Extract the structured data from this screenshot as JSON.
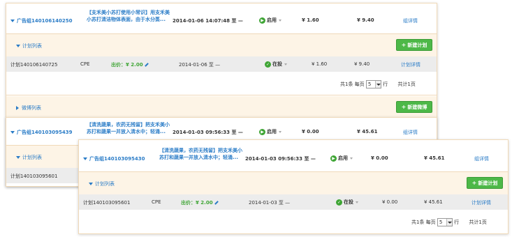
{
  "back": {
    "ad1": {
      "group_label": "广告组140106140250",
      "title": "【支禾美小苏打使用小常识】用支禾美小苏打清洁物体表面，由于水分蒸...",
      "date": "2014-01-06 14:07:48 至 —",
      "status": "启用",
      "price1": "¥ 1.60",
      "price2": "¥ 9.40",
      "detail": "组详情",
      "plan_list": "计划列表",
      "new_plan_btn": "新建计划",
      "plan": {
        "name": "计划140106140725",
        "type": "CPE",
        "bid_label": "出价：¥ 2.00",
        "date": "2014-01-06 至 —",
        "status": "在投",
        "v1": "¥ 1.60",
        "v2": "¥ 9.40",
        "detail": "计划详情"
      },
      "pager": {
        "total": "共1条 每页",
        "size": "5",
        "unit": "行",
        "pages": "共计1页"
      },
      "weibo_list": "微博列表",
      "new_weibo_btn": "新建微博"
    },
    "ad2": {
      "group_label": "广告组140103095439",
      "title": "【清洗蔬果，农药无残留】把支禾美小苏打和蔬果一并放入清水中；轻涌...",
      "date": "2014-01-03 09:56:33 至 —",
      "status": "启用",
      "price1": "¥ 0.00",
      "price2": "¥ 45.61",
      "detail": "组详情",
      "plan_list": "计划列表",
      "plan_name": "计划140103095601"
    }
  },
  "front": {
    "group_label": "广告组140103095430",
    "title": "【清洗蔬果，农药无残留】把支禾美小苏打和蔬果一并放入清水中；轻涌...",
    "date": "2014-01-03 09:56:33 至 —",
    "status": "启用",
    "price1": "¥ 0.00",
    "price2": "¥ 45.61",
    "detail": "组详情",
    "plan_list": "计划列表",
    "new_plan_btn": "新建计划",
    "plan": {
      "name": "计划140103095601",
      "type": "CPE",
      "bid_label": "出价：¥ 2.00",
      "date": "2014-01-03 至 —",
      "status": "在投",
      "v1": "¥ 0.00",
      "v2": "¥ 45.61",
      "detail": "计划详情"
    },
    "pager": {
      "total": "共1条 每页",
      "size": "5",
      "unit": "行",
      "pages": "共计1页"
    }
  },
  "colors": {
    "accent": "#2a7cc7",
    "green": "#4db848",
    "orange_border": "#f0d9b8",
    "price_green": "#3fa535"
  }
}
